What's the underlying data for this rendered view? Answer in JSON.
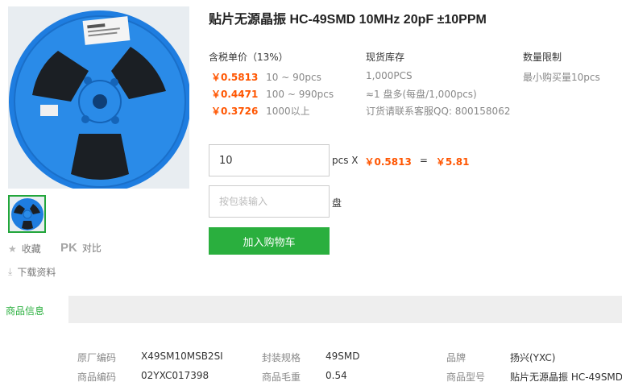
{
  "product": {
    "title": "贴片无源晶振 HC-49SMD 10MHz 20pF ±10PPM"
  },
  "side": {
    "favorite_label": "收藏",
    "compare_label": "对比",
    "compare_mark": "PK",
    "download_label": "下载资料"
  },
  "pricing": {
    "header": "含税单价（13%）",
    "tiers": [
      {
        "price": "￥0.5813",
        "range": "10 ~ 90pcs"
      },
      {
        "price": "￥0.4471",
        "range": "100 ~ 990pcs"
      },
      {
        "price": "￥0.3726",
        "range": "1000以上"
      }
    ]
  },
  "stock": {
    "header": "现货库存",
    "lines": [
      "1,000PCS",
      "≈1 盘多(每盘/1,000pcs)",
      "订货请联系客服QQ: 800158062"
    ]
  },
  "limit": {
    "header": "数量限制",
    "text": "最小购买量10pcs"
  },
  "order": {
    "quantity_value": "10",
    "calc_unit": "pcs X",
    "calc_price": "￥0.5813",
    "calc_eq": "=",
    "calc_total": "￥5.81",
    "package_placeholder": "按包装输入",
    "package_unit": "盘",
    "add_to_cart": "加入购物车"
  },
  "tabs": {
    "active": "商品信息"
  },
  "specs": [
    {
      "key": "原厂编码",
      "value": "X49SM10MSB2SI"
    },
    {
      "key": "封装规格",
      "value": "49SMD"
    },
    {
      "key": "品牌",
      "value": "扬兴(YXC)"
    },
    {
      "key": "商品编码",
      "value": "02YXC017398"
    },
    {
      "key": "商品毛重",
      "value": "0.54"
    },
    {
      "key": "商品型号",
      "value": "贴片无源晶振 HC-49SMD."
    }
  ],
  "reel_label": {
    "logo": "YXC",
    "logo_color": "#2a6fd6"
  },
  "colors": {
    "price": "#ff5500",
    "accent_green": "#2aaf3e",
    "reel_blue": "#1f7fe0"
  }
}
